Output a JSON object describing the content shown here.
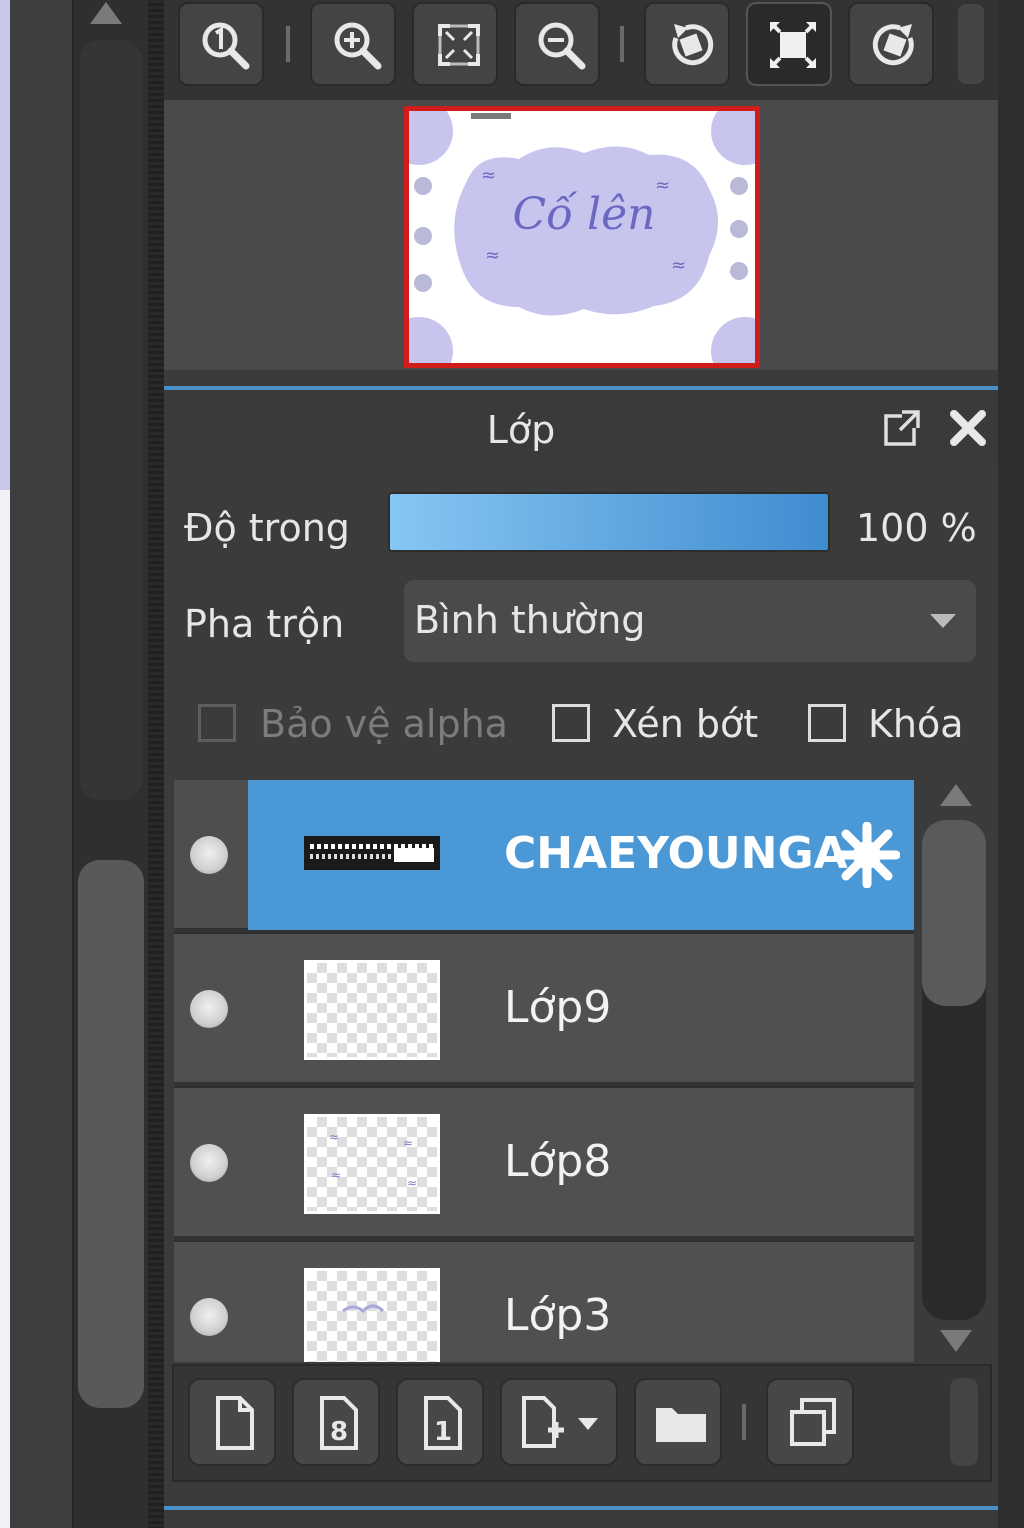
{
  "navigator": {
    "preview_text": "Cố lên"
  },
  "layer_panel": {
    "title": "Lớp",
    "opacity_label": "Độ trong",
    "opacity_value": "100 %",
    "opacity_percent": 100,
    "blend_label": "Pha trộn",
    "blend_value": "Bình thường",
    "options": {
      "protect_alpha": "Bảo vệ alpha",
      "clipping": "Xén bớt",
      "lock": "Khóa"
    },
    "layers": [
      {
        "name": "CHAEYOUNGA",
        "selected": true
      },
      {
        "name": "Lớp9",
        "selected": false
      },
      {
        "name": "Lớp8",
        "selected": false
      },
      {
        "name": "Lớp3",
        "selected": false
      }
    ]
  },
  "colors": {
    "accent": "#4a90c8",
    "selected_row": "#4b98d6",
    "preview_border": "#d11c1c",
    "preview_tint": "#c7c5ee"
  }
}
